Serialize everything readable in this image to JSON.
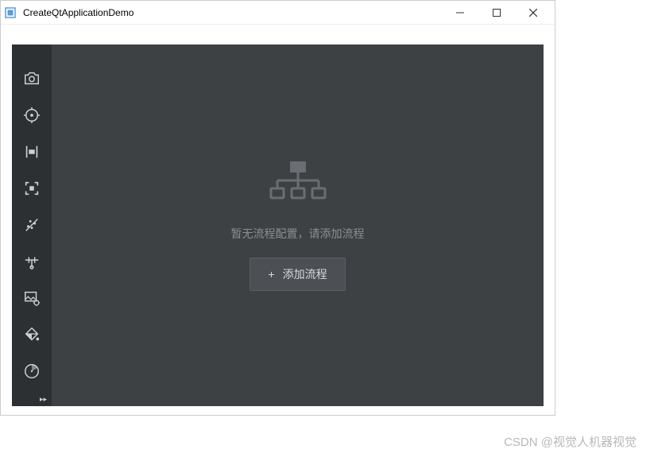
{
  "window": {
    "title": "CreateQtApplicationDemo"
  },
  "sidebar": {
    "tools": [
      {
        "id": "camera",
        "name": "camera-icon"
      },
      {
        "id": "target",
        "name": "target-icon"
      },
      {
        "id": "caliper",
        "name": "caliper-icon"
      },
      {
        "id": "focus",
        "name": "focus-icon"
      },
      {
        "id": "scatter",
        "name": "scatter-icon"
      },
      {
        "id": "slider",
        "name": "slider-icon"
      },
      {
        "id": "image-settings",
        "name": "image-settings-icon"
      },
      {
        "id": "paint",
        "name": "paint-icon"
      },
      {
        "id": "radar",
        "name": "radar-icon"
      }
    ]
  },
  "empty_state": {
    "message": "暂无流程配置，请添加流程",
    "button_label": "添加流程",
    "plus": "+"
  },
  "watermark": "CSDN @视觉人机器视觉"
}
